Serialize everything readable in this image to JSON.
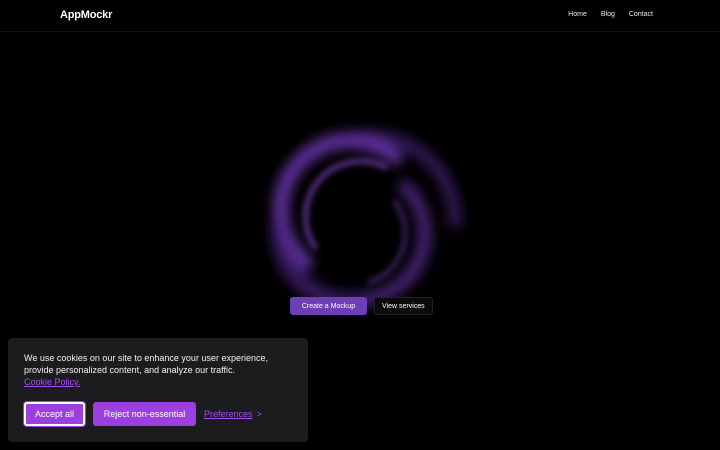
{
  "header": {
    "logo": "AppMockr",
    "nav": [
      "Home",
      "Blog",
      "Contact"
    ]
  },
  "hero": {
    "primary_label": "Create a Mockup",
    "secondary_label": "View services"
  },
  "cookie": {
    "text": "We use cookies on our site to enhance your user experience, provide personalized content, and analyze our traffic.",
    "policy_link": "Cookie Policy.",
    "accept_label": "Accept all",
    "reject_label": "Reject non-essential",
    "preferences_label": "Preferences",
    "preferences_chevron": ">"
  },
  "colors": {
    "background": "#000000",
    "accent": "#9b3fe0",
    "primary_button": "#6c3fb5",
    "banner": "#1c1c1e",
    "glow": "#7a3fc0"
  },
  "icons": {
    "hero_graphic": "glow-ring-icon"
  }
}
